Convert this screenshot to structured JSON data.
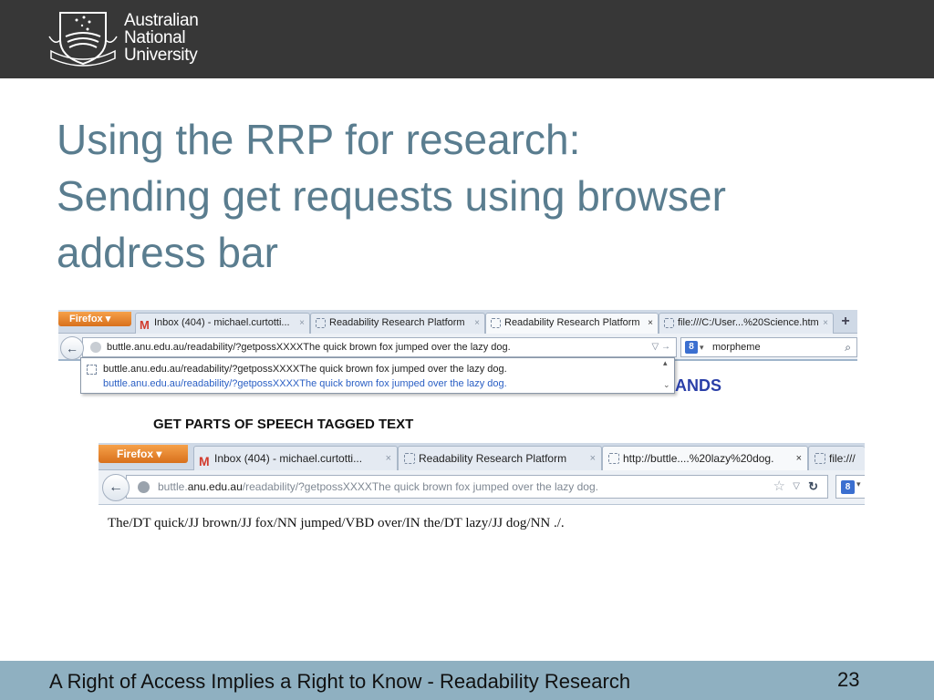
{
  "header": {
    "logo": {
      "icon": "anu-crest-icon",
      "lines": [
        "Australian",
        "National",
        "University"
      ]
    }
  },
  "title": {
    "lines": [
      "Using the RRP for research:",
      "Sending get requests using browser",
      "address bar"
    ]
  },
  "browser1": {
    "firefox_label": "Firefox",
    "tabs": [
      {
        "label": "Inbox (404) - michael.curtotti...",
        "icon": "gmail-icon",
        "close": "×"
      },
      {
        "label": "Readability Research Platform",
        "icon": "page-icon",
        "close": "×"
      },
      {
        "label": "Readability Research Platform",
        "icon": "page-icon",
        "close": "×",
        "active": true
      },
      {
        "label": "file:///C:/User...%20Science.htm",
        "icon": "page-icon",
        "close": "×"
      }
    ],
    "new_tab": "+",
    "back": "←",
    "url": "buttle.anu.edu.au/readability/?getpossXXXXThe quick brown fox jumped over the lazy dog.",
    "url_controls": "▽ →",
    "search": {
      "engine_badge": "8",
      "value": "morpheme",
      "icon": "magnifier-icon"
    },
    "dropdown": {
      "row_title": "buttle.anu.edu.au/readability/?getpossXXXXThe quick brown fox jumped over the lazy dog.",
      "row_url": "buttle.anu.edu.au/readability/?getpossXXXXThe quick brown fox jumped over the lazy dog."
    }
  },
  "partial_text": "ANDS",
  "section_heading": "GET PARTS OF SPEECH TAGGED TEXT",
  "browser2": {
    "firefox_label": "Firefox",
    "tabs": [
      {
        "label": "Inbox (404) - michael.curtotti...",
        "icon": "gmail-icon",
        "close": "×"
      },
      {
        "label": "Readability Research Platform",
        "icon": "page-icon",
        "close": "×"
      },
      {
        "label": "http://buttle....%20lazy%20dog.",
        "icon": "page-icon",
        "close": "×",
        "active": true
      },
      {
        "label": "file:///",
        "icon": "page-icon"
      }
    ],
    "back": "←",
    "url_host": "buttle.anu.edu.au",
    "url_prefix": "buttle.",
    "url_host_bold": "anu.edu.au",
    "url_rest": "/readability/?getpossXXXXThe quick brown fox jumped over the lazy dog.",
    "search": {
      "engine_badge": "8"
    }
  },
  "tagged_output": "The/DT quick/JJ brown/JJ fox/NN jumped/VBD over/IN the/DT lazy/JJ dog/NN ./.",
  "footer": {
    "text": "A Right of Access Implies a Right to Know - Readability Research",
    "page_number": "23"
  },
  "colors": {
    "header_bg": "#373737",
    "title": "#5a7d8f",
    "footer_bg": "#8fb0c1",
    "link_blue": "#2a5fc4",
    "firefox_orange": "#e07a24"
  }
}
